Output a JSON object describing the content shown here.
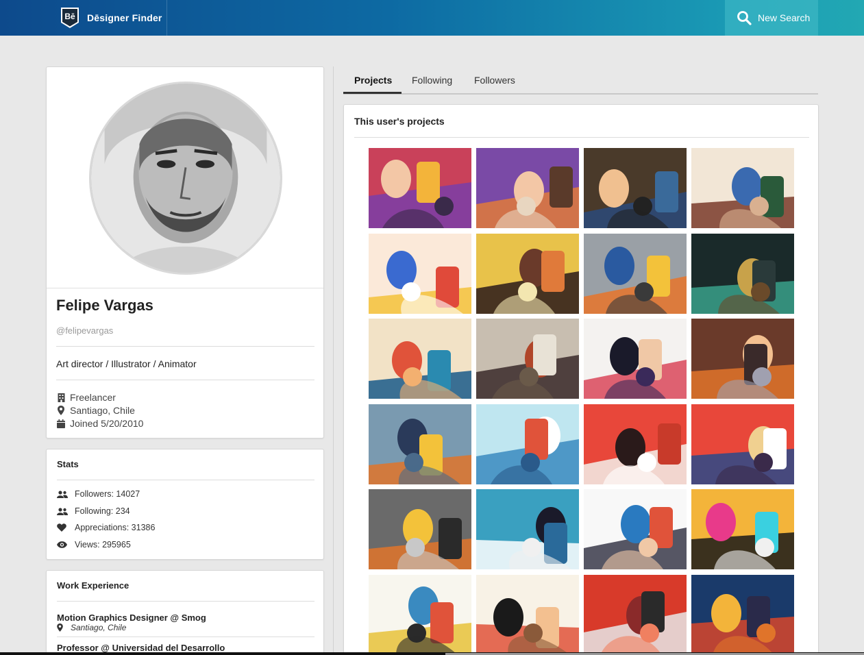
{
  "header": {
    "app_name": "Dēsigner Finder",
    "logo_text": "Bē",
    "new_search_label": "New Search"
  },
  "profile": {
    "name": "Felipe Vargas",
    "handle": "@felipevargas",
    "role": "Art director / Illustrator / Animator",
    "company": "Freelancer",
    "location": "Santiago, Chile",
    "joined": "Joined 5/20/2010"
  },
  "stats": {
    "title": "Stats",
    "followers": "Followers: 14027",
    "following": "Following: 234",
    "appreciations": "Appreciations: 31386",
    "views": "Views: 295965"
  },
  "work": {
    "title": "Work Experience",
    "jobs": [
      {
        "title": "Motion Graphics Designer @ Smog",
        "location": "Santiago, Chile"
      },
      {
        "title": "Professor @ Universidad del Desarrollo"
      }
    ]
  },
  "tabs": [
    {
      "label": "Projects",
      "active": true
    },
    {
      "label": "Following",
      "active": false
    },
    {
      "label": "Followers",
      "active": false
    }
  ],
  "projects": {
    "title": "This user's projects",
    "thumbnails": [
      {
        "name": "woman-glasses",
        "bg": "#c9415a",
        "colors": [
          "#7a3ea8",
          "#f3c7a6",
          "#f3b43a",
          "#3a2a4a"
        ]
      },
      {
        "name": "bearded-men-coffee",
        "bg": "#7a4aa6",
        "colors": [
          "#e07a3a",
          "#f3c7a6",
          "#5a3a2a",
          "#e8d6c0"
        ]
      },
      {
        "name": "men-in-caps",
        "bg": "#4a3a2a",
        "colors": [
          "#2a4a7a",
          "#f0c090",
          "#3a6a9a",
          "#222222"
        ]
      },
      {
        "name": "family-portrait",
        "bg": "#f2e6d6",
        "colors": [
          "#7a3a2a",
          "#3a6ab0",
          "#2a5a3a",
          "#d9b090"
        ]
      },
      {
        "name": "hands-gesture",
        "bg": "#fbe9d9",
        "colors": [
          "#f3c23a",
          "#3a6ad0",
          "#e04a3a",
          "#ffffff"
        ]
      },
      {
        "name": "market-crowd",
        "bg": "#e8c24a",
        "colors": [
          "#2a1a1a",
          "#6a3a2a",
          "#e07a3a",
          "#f3e6b0"
        ]
      },
      {
        "name": "number-six",
        "bg": "#9aa0a6",
        "colors": [
          "#e8742a",
          "#2a5aa0",
          "#f3c23a",
          "#3a3a3a"
        ]
      },
      {
        "name": "woman-violin",
        "bg": "#1a2a2a",
        "colors": [
          "#3aa08a",
          "#c8a24a",
          "#2a3a3a",
          "#6a4a2a"
        ]
      },
      {
        "name": "harbor-city",
        "bg": "#f2e2c6",
        "colors": [
          "#1a5a8a",
          "#e0533a",
          "#2a8ab0",
          "#f3b070"
        ]
      },
      {
        "name": "nigeria-street",
        "bg": "#c8beb0",
        "colors": [
          "#3a2a2a",
          "#b0462a",
          "#e8e2d6",
          "#6a5a4a"
        ]
      },
      {
        "name": "man-profile-pink",
        "bg": "#f4f2f0",
        "colors": [
          "#d9485a",
          "#1a1a2a",
          "#f0c8a6",
          "#3a2a5a"
        ]
      },
      {
        "name": "woman-fox-orange",
        "bg": "#6a3a2a",
        "colors": [
          "#e0742a",
          "#f3c090",
          "#3a2a2a",
          "#a0a0b0"
        ]
      },
      {
        "name": "bird-science",
        "bg": "#7a9ab0",
        "colors": [
          "#e0742a",
          "#2a3a5a",
          "#f3c23a",
          "#4a6a8a"
        ]
      },
      {
        "name": "kitchen-scene",
        "bg": "#bfe6f0",
        "colors": [
          "#3a8ac0",
          "#ffffff",
          "#e0533a",
          "#2a5a8a"
        ]
      },
      {
        "name": "hand-drawing",
        "bg": "#e8473a",
        "colors": [
          "#f3f0ea",
          "#2a1a1a",
          "#c83a2a",
          "#ffffff"
        ]
      },
      {
        "name": "windmill-sunset",
        "bg": "#e8473a",
        "colors": [
          "#2a4a8a",
          "#f0d090",
          "#ffffff",
          "#3a2a4a"
        ]
      },
      {
        "name": "woman-guitar",
        "bg": "#6a6a6a",
        "colors": [
          "#e0742a",
          "#f3c23a",
          "#2a2a2a",
          "#c8c8c8"
        ]
      },
      {
        "name": "woman-blue-poster",
        "bg": "#3aa0c0",
        "colors": [
          "#ffffff",
          "#1a1a2a",
          "#2a6a9a",
          "#f0f0f0"
        ]
      },
      {
        "name": "business-team",
        "bg": "#f8f8f8",
        "colors": [
          "#3a3a4a",
          "#2a7ac0",
          "#e0533a",
          "#f0c8a6"
        ]
      },
      {
        "name": "mtv-millennial-awards",
        "bg": "#f3b43a",
        "colors": [
          "#1a1a1a",
          "#e83a8a",
          "#3ad0e0",
          "#f0f0f0"
        ]
      },
      {
        "name": "musicians",
        "bg": "#f8f6ee",
        "colors": [
          "#e8c23a",
          "#3a8ac0",
          "#e0533a",
          "#2a2a2a"
        ]
      },
      {
        "name": "jazz-bassist",
        "bg": "#f8f2e6",
        "colors": [
          "#e0533a",
          "#1a1a1a",
          "#f3c090",
          "#8a5a3a"
        ]
      },
      {
        "name": "stormtrooper",
        "bg": "#d83a2a",
        "colors": [
          "#e8e8e8",
          "#8a2a2a",
          "#2a2a2a",
          "#f08060"
        ]
      },
      {
        "name": "man-in-suit-bridge",
        "bg": "#1a3a6a",
        "colors": [
          "#d8462a",
          "#f3b43a",
          "#2a2a4a",
          "#e0742a"
        ]
      }
    ]
  }
}
